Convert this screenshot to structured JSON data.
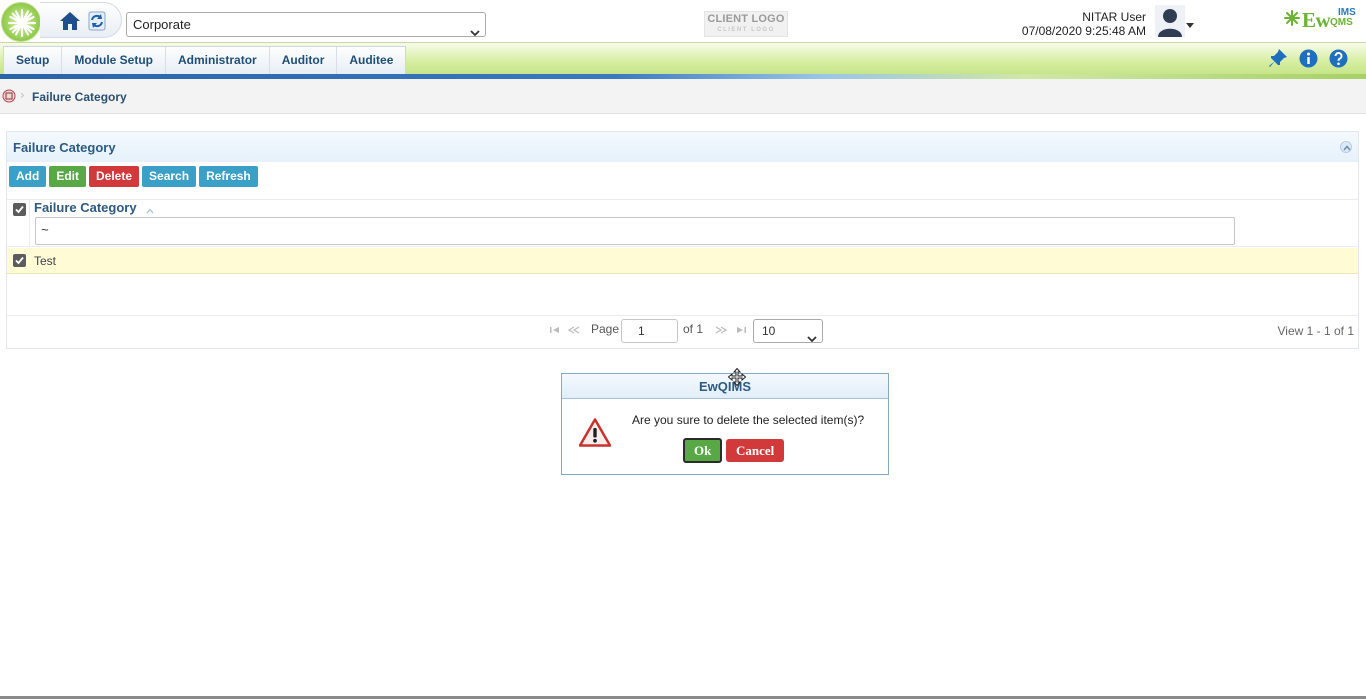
{
  "header": {
    "org_select_value": "Corporate",
    "client_logo_text": "CLIENT LOGO",
    "client_logo_subtext": "CLIENT LOGO",
    "user_name": "NITAR User",
    "datetime": "07/08/2020 9:25:48 AM",
    "brand_main": "Ew",
    "brand_ims": "IMS",
    "brand_qms": "QMS"
  },
  "menu": {
    "items": [
      {
        "label": "Setup"
      },
      {
        "label": "Module Setup"
      },
      {
        "label": "Administrator"
      },
      {
        "label": "Auditor"
      },
      {
        "label": "Auditee"
      }
    ],
    "icons": [
      "pin-icon",
      "info-icon",
      "help-icon"
    ]
  },
  "breadcrumb": {
    "current": "Failure Category"
  },
  "panel": {
    "title": "Failure Category",
    "toolbar": {
      "add": "Add",
      "edit": "Edit",
      "delete": "Delete",
      "search": "Search",
      "refresh": "Refresh"
    },
    "grid": {
      "column_header": "Failure Category",
      "filter_value": "~",
      "rows": [
        {
          "value": "Test",
          "checked": true
        }
      ]
    },
    "pager": {
      "page_label": "Page",
      "page_value": "1",
      "of_label": "of 1",
      "page_size": "10",
      "view_text": "View 1 - 1 of 1"
    }
  },
  "dialog": {
    "title": "EwQIMS",
    "message": "Are you sure to delete the selected item(s)?",
    "ok_label": "Ok",
    "cancel_label": "Cancel"
  },
  "colors": {
    "accent_blue": "#2c5a85",
    "add": "#3aa0c8",
    "edit": "#58a946",
    "delete": "#d2393a",
    "row_highlight": "#fefbd5",
    "menu_green": "#c7e58a"
  }
}
